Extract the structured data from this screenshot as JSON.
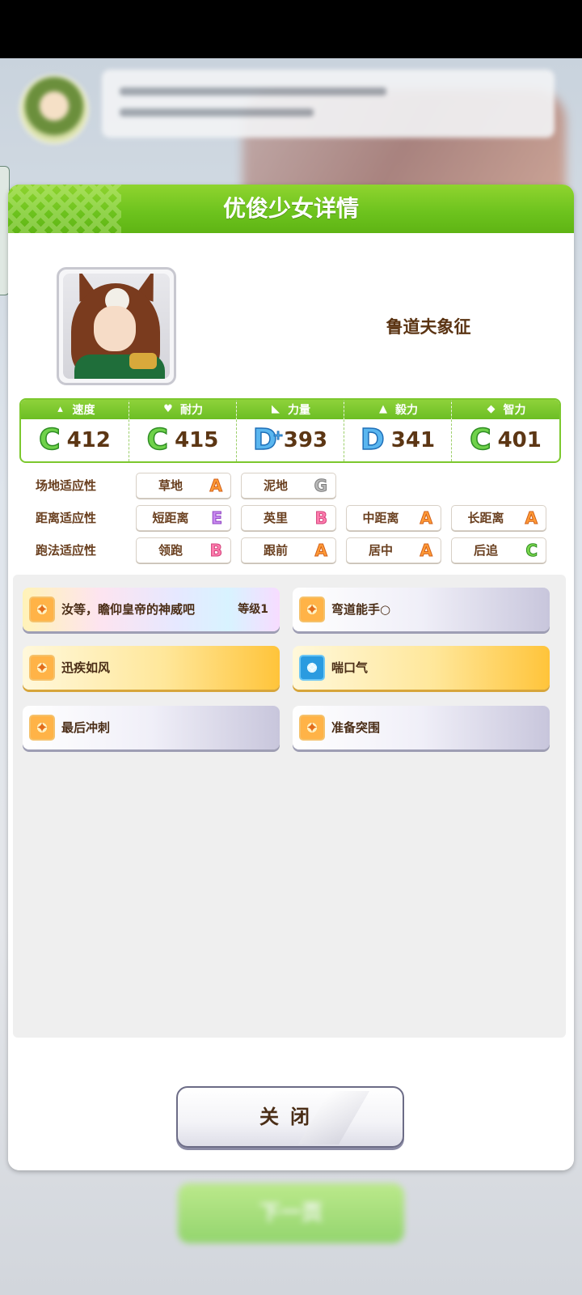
{
  "modal": {
    "title": "优俊少女详情",
    "character_name": "鲁道夫象征"
  },
  "stats": [
    {
      "label": "速度",
      "icon": "shoe-icon",
      "grade": "C",
      "value": "412"
    },
    {
      "label": "耐力",
      "icon": "heart-icon",
      "grade": "C",
      "value": "415"
    },
    {
      "label": "力量",
      "icon": "muscle-icon",
      "grade": "D",
      "value": "393",
      "plus": "+"
    },
    {
      "label": "毅力",
      "icon": "flame-icon",
      "grade": "D",
      "value": "341"
    },
    {
      "label": "智力",
      "icon": "graduation-cap-icon",
      "grade": "C",
      "value": "401"
    }
  ],
  "aptitudes": {
    "track": {
      "label": "场地适应性",
      "items": [
        {
          "name": "草地",
          "grade": "A"
        },
        {
          "name": "泥地",
          "grade": "G"
        }
      ]
    },
    "distance": {
      "label": "距离适应性",
      "items": [
        {
          "name": "短距离",
          "grade": "E"
        },
        {
          "name": "英里",
          "grade": "B"
        },
        {
          "name": "中距离",
          "grade": "A"
        },
        {
          "name": "长距离",
          "grade": "A"
        }
      ]
    },
    "style": {
      "label": "跑法适应性",
      "items": [
        {
          "name": "领跑",
          "grade": "B"
        },
        {
          "name": "跟前",
          "grade": "A"
        },
        {
          "name": "居中",
          "grade": "A"
        },
        {
          "name": "后追",
          "grade": "C"
        }
      ]
    }
  },
  "skills": [
    {
      "name": "汝等，瞻仰皇帝的神威吧",
      "level": "等级1",
      "style": "rainbow"
    },
    {
      "name": "弯道能手○",
      "style": "white"
    },
    {
      "name": "迅疾如风",
      "style": "gold"
    },
    {
      "name": "喘口气",
      "style": "gold"
    },
    {
      "name": "最后冲刺",
      "style": "white"
    },
    {
      "name": "准备突围",
      "style": "white"
    }
  ],
  "buttons": {
    "close": "关闭",
    "next": "下一页"
  },
  "colors": {
    "header_green": "#6cc21d",
    "grade_A": "#ff9a36",
    "grade_B": "#ff7fb0",
    "grade_C": "#7ad64c",
    "grade_D": "#5ab6ef",
    "grade_E": "#c98af0",
    "grade_G": "#b9b9b9"
  }
}
